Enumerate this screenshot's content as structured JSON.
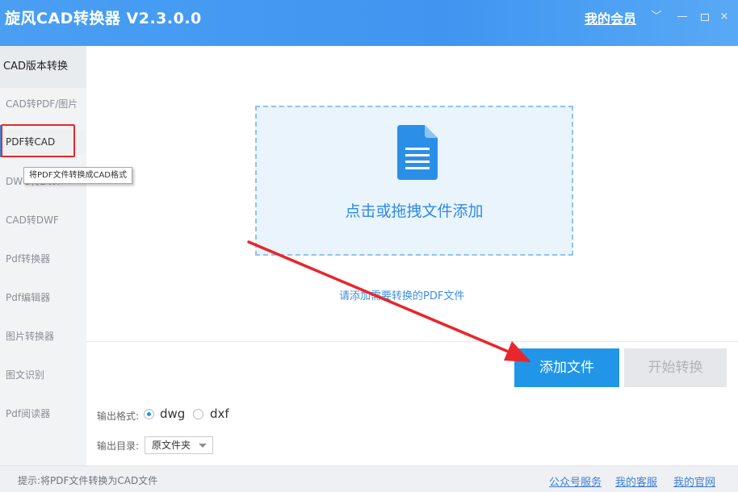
{
  "app": {
    "title": "旋风CAD转换器 V2.3.0.0",
    "member_link": "我的会员"
  },
  "window_controls": {
    "chevron": "﹀",
    "minimize": "—",
    "close": "×"
  },
  "sidebar": {
    "header": "CAD版本转换",
    "items": [
      {
        "label": "CAD转PDF/图片"
      },
      {
        "label": "PDF转CAD",
        "active": true,
        "highlighted": true
      },
      {
        "label": "DWG转DWF"
      },
      {
        "label": "CAD转DWF"
      },
      {
        "label": "Pdf转换器"
      },
      {
        "label": "Pdf编辑器"
      },
      {
        "label": "图片转换器"
      },
      {
        "label": "图文识别"
      },
      {
        "label": "Pdf阅读器"
      }
    ],
    "tooltip": "将PDF文件转换成CAD格式"
  },
  "dropzone": {
    "text": "点击或拖拽文件添加",
    "icon": "document-icon"
  },
  "hint": "请添加需要转换的PDF文件",
  "buttons": {
    "add_files": "添加文件",
    "start_convert": "开始转换"
  },
  "output": {
    "format_label": "输出格式:",
    "format_options": [
      "dwg",
      "dxf"
    ],
    "format_selected": "dwg",
    "dir_label": "输出目录:",
    "dir_value": "原文件夹"
  },
  "statusbar": {
    "text": "提示:将PDF文件转换为CAD文件",
    "links": [
      "公众号服务",
      "我的客服",
      "我的官网"
    ]
  },
  "colors": {
    "accent": "#2196e8",
    "titlebar": "#4a9ff3",
    "highlight": "#e8262c",
    "annotation_arrow": "#e8262c"
  }
}
